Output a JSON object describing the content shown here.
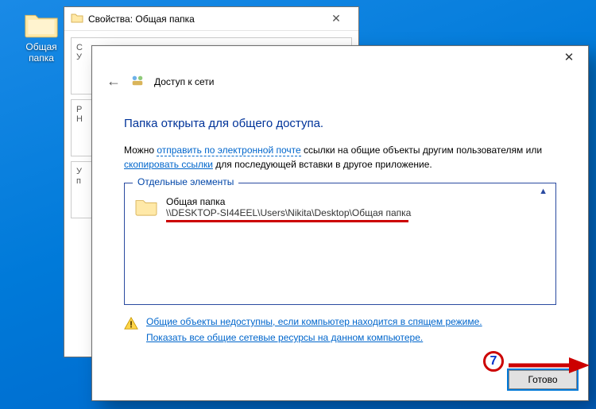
{
  "desktop": {
    "icon_label": "Общая папка"
  },
  "props_window": {
    "title": "Свойства: Общая папка",
    "row_labels": [
      "С",
      "У",
      "Р",
      "Н",
      "У",
      "п"
    ]
  },
  "wizard": {
    "header_title": "Доступ к сети",
    "headline": "Папка открыта для общего доступа.",
    "body_prefix": "Можно ",
    "link_email": "отправить по электронной почте",
    "body_mid1": " ссылки на общие объекты другим пользователям или ",
    "link_copy": "скопировать ссылки",
    "body_suffix": " для последующей вставки в другое приложение.",
    "group_legend": "Отдельные элементы",
    "share": {
      "name": "Общая папка",
      "path": "\\\\DESKTOP-SI44EEL\\Users\\Nikita\\Desktop\\Общая папка"
    },
    "warn_link1": "Общие объекты недоступны, если компьютер находится в спящем режиме.",
    "warn_link2": "Показать все общие сетевые ресурсы на данном компьютере.",
    "done_label": "Готово",
    "annotation_number": "7"
  }
}
